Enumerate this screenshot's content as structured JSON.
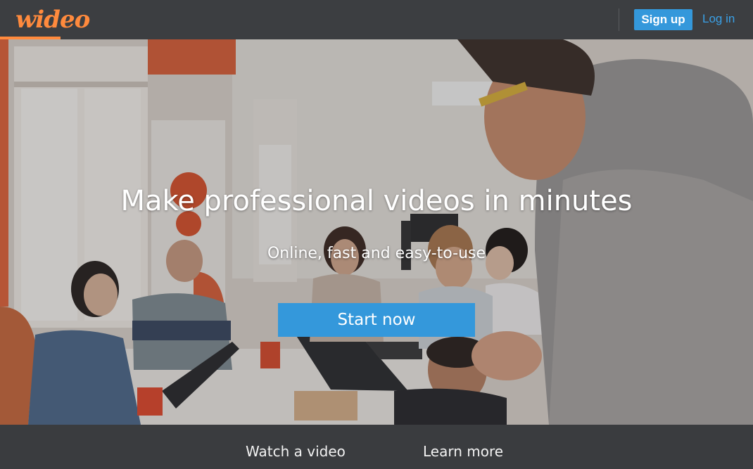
{
  "header": {
    "logo_text": "wideo",
    "signup_label": "Sign up",
    "login_label": "Log in",
    "brand_color": "#ff8a3d",
    "accent_color": "#3498db"
  },
  "hero": {
    "headline": "Make professional videos in minutes",
    "subheadline": "Online, fast and easy-to-use",
    "cta_label": "Start now"
  },
  "footer": {
    "watch_label": "Watch a video",
    "learn_label": "Learn more"
  }
}
